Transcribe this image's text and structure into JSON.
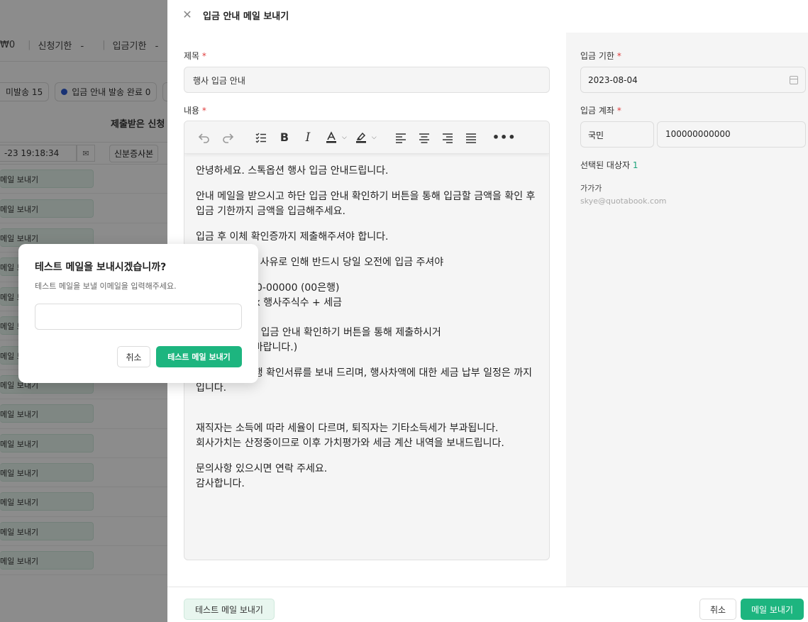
{
  "background": {
    "filters": {
      "amount": "₩0",
      "apply_deadline_label": "신청기한",
      "apply_deadline_value": "-",
      "payment_deadline_label": "입금기한",
      "payment_deadline_value": "-"
    },
    "chips": {
      "unsent": "미발송 15",
      "sent_done": "입금 안내 발송 완료 0"
    },
    "column_header": "제출받은 신청 서",
    "first_row": {
      "datetime": "-23 19:18:34",
      "doc": "신분증사본"
    },
    "row_button_label": "메일 보내기",
    "row_count": 14
  },
  "drawer": {
    "title": "입금 안내 메일 보내기",
    "subject": {
      "label": "제목",
      "value": "행사 입금 안내"
    },
    "content": {
      "label": "내용",
      "paragraphs": [
        "안녕하세요. 스톡옵션 행사 입금 안내드립니다.",
        "안내 메일을 받으시고 하단 입금 안내 확인하기 버튼을 통해 입금할 금액을 확인 후 입금 기한까지 금액을 입금해주세요.",
        "입금 후 이체 확인증까지 제출해주셔야 합니다.",
        "주금 납입 등기 사유로 인해 반드시 당일 오전에 입금 주셔야",
        "좌 : 1000-000-00000 (00은행)\n액 : 행사가액 x 행사주식수 + 세금\n요한 서류 :\n체확인증 (하단 입금 안내 확인하기 버튼을 통해 제출하시거\n이메일로 제출바랍니다.)",
        "에는 주권미발행 확인서류를 보내 드리며, 행사차액에 대한 세금 납부 일정은 까지 입니다.",
        "",
        "재직자는 소득에 따라 세율이 다르며, 퇴직자는 기타소득세가 부과됩니다.\n회사가치는 산정중이므로 이후 가치평가와 세금 계산 내역을 보내드립니다.",
        "문의사항 있으시면 연락 주세요.\n감사합니다."
      ]
    },
    "toolbar_icons": [
      "undo-icon",
      "redo-icon",
      "checklist-icon",
      "bold-icon",
      "italic-icon",
      "text-color-icon",
      "highlight-icon",
      "align-left-icon",
      "align-center-icon",
      "align-right-icon",
      "align-justify-icon",
      "more-icon"
    ],
    "deadline": {
      "label": "입금 기한",
      "value": "2023-08-04"
    },
    "account": {
      "label": "입금 계좌",
      "bank": "국민",
      "number": "100000000000"
    },
    "selected": {
      "label": "선택된 대상자",
      "count": "1"
    },
    "recipient": {
      "name": "가가가",
      "email": "skye@quotabook.com"
    },
    "footer": {
      "test_button": "테스트 메일 보내기",
      "cancel_button": "취소",
      "send_button": "메일 보내기"
    }
  },
  "modal": {
    "title": "테스트 메일을 보내시겠습니까?",
    "description": "테스트 메일을 보낼 이메일을 입력해주세요.",
    "input_value": "",
    "cancel": "취소",
    "confirm": "테스트 메일 보내기"
  },
  "colors": {
    "accent": "#1db57f",
    "accent_light": "#e8f6ef",
    "required": "#e03d3d"
  }
}
